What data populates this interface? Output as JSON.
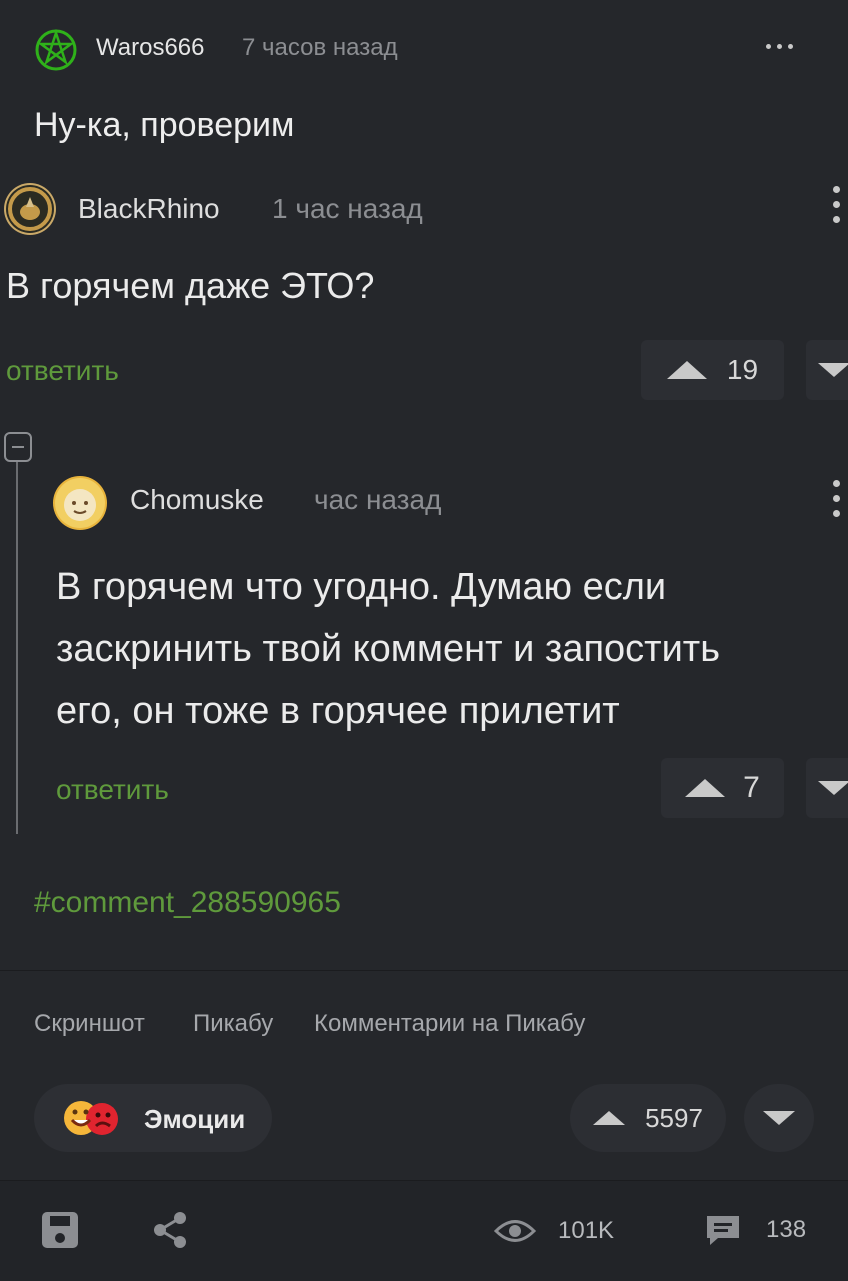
{
  "post": {
    "author": "Waros666",
    "time": "7 часов назад",
    "title": "Ну-ка, проверим"
  },
  "comment1": {
    "author": "BlackRhino",
    "time": "1 час назад",
    "text": "В горячем даже ЭТО?",
    "reply_label": "ответить",
    "votes": "19"
  },
  "comment2": {
    "author": "Chomuske",
    "time": "час назад",
    "text_lines": [
      "В горячем что угодно. Думаю если",
      "заскринить твой коммент и запостить",
      "его, он тоже в горячее прилетит"
    ],
    "reply_label": "ответить",
    "votes": "7"
  },
  "comment_link": "#comment_288590965",
  "tags": [
    "Скриншот",
    "Пикабу",
    "Комментарии на Пикабу"
  ],
  "emotions_label": "Эмоции",
  "post_votes": "5597",
  "footer": {
    "views": "101K",
    "comments": "138"
  },
  "colors": {
    "background": "#25272b",
    "accent_green": "#5f9a3c",
    "muted": "#8c8e92"
  }
}
